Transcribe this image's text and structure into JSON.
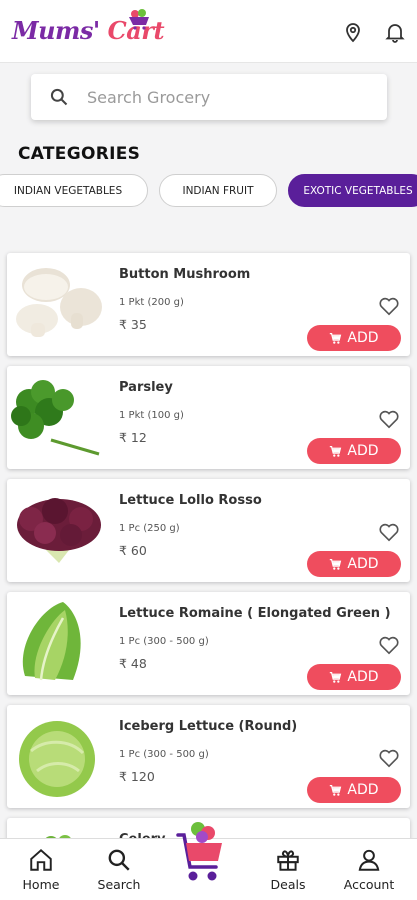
{
  "header": {
    "logo_text_a": "Mums'",
    "logo_text_b": "Cart",
    "icons": [
      "location-pin-icon",
      "bell-icon"
    ]
  },
  "search": {
    "placeholder": "Search Grocery",
    "value": ""
  },
  "categories": {
    "title": "CATEGORIES",
    "chips": [
      {
        "label": "INDIAN VEGETABLES",
        "active": false
      },
      {
        "label": "INDIAN FRUIT",
        "active": false
      },
      {
        "label": "EXOTIC VEGETABLES",
        "active": true
      }
    ]
  },
  "colors": {
    "brand_purple": "#5a1f9a",
    "add_red": "#ef4d5e"
  },
  "products": [
    {
      "name": "Button Mushroom",
      "qty": "1 Pkt (200 g)",
      "price": "₹ 35",
      "add_label": "ADD"
    },
    {
      "name": "Parsley",
      "qty": "1 Pkt (100 g)",
      "price": "₹ 12",
      "add_label": "ADD"
    },
    {
      "name": "Lettuce Lollo Rosso",
      "qty": "1 Pc (250 g)",
      "price": "₹ 60",
      "add_label": "ADD"
    },
    {
      "name": "Lettuce Romaine ( Elongated Green )",
      "qty": "1 Pc (300 - 500 g)",
      "price": "₹ 48",
      "add_label": "ADD"
    },
    {
      "name": "Iceberg Lettuce (Round)",
      "qty": "1 Pc (300 - 500 g)",
      "price": "₹ 120",
      "add_label": "ADD"
    },
    {
      "name": "Celery"
    }
  ],
  "bottom_nav": [
    {
      "label": "Home",
      "icon": "home-icon"
    },
    {
      "label": "Search",
      "icon": "search-icon"
    },
    {
      "label": "",
      "icon": "cart-icon"
    },
    {
      "label": "Deals",
      "icon": "gift-icon"
    },
    {
      "label": "Account",
      "icon": "user-icon"
    }
  ]
}
